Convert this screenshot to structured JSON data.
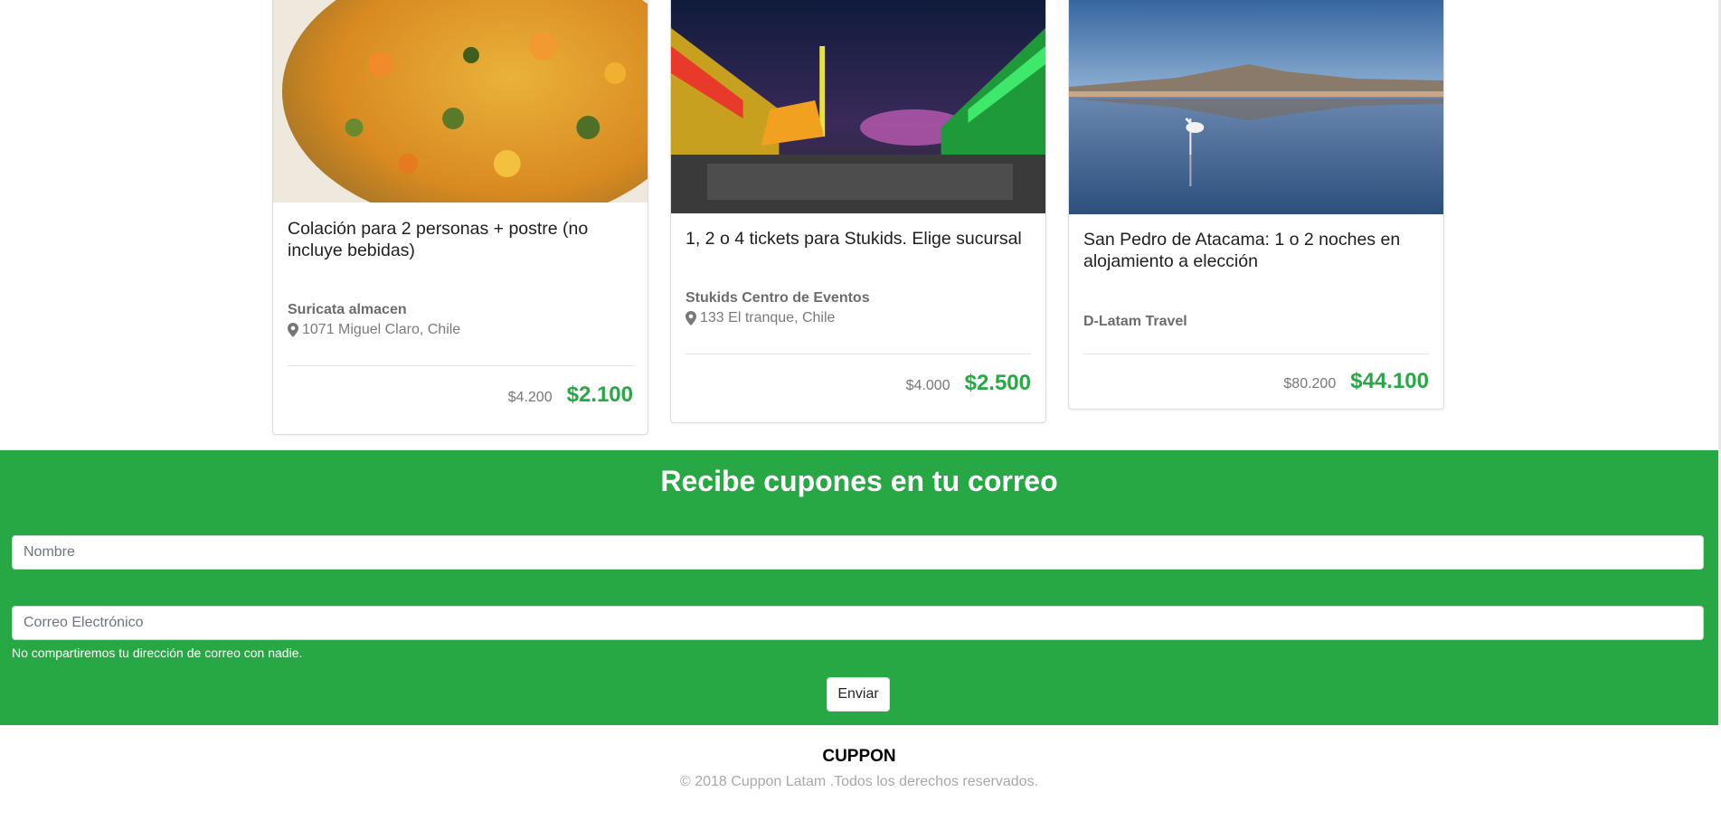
{
  "deals": [
    {
      "image": "food-dish-image",
      "title": "Colación para 2 personas + postre (no incluye bebidas)",
      "merchant": "Suricata almacen",
      "location": "1071 Miguel Claro, Chile",
      "old_price": "$4.200",
      "new_price": "$2.100"
    },
    {
      "image": "amusement-fair-image",
      "title": "1, 2 o 4 tickets para Stukids. Elige sucursal",
      "merchant": "Stukids Centro de Eventos",
      "location": "133 El tranque, Chile",
      "old_price": "$4.000",
      "new_price": "$2.500"
    },
    {
      "image": "flamingo-lake-image",
      "title": "San Pedro de Atacama: 1 o 2 noches en alojamiento a elección",
      "merchant": "D-Latam Travel",
      "location": "",
      "old_price": "$80.200",
      "new_price": "$44.100"
    }
  ],
  "newsletter": {
    "heading": "Recibe cupones en tu correo",
    "name_placeholder": "Nombre",
    "name_value": "",
    "email_placeholder": "Correo Electrónico",
    "email_value": "",
    "help_text": "No compartiremos tu dirección de correo con nadie.",
    "submit_label": "Enviar"
  },
  "footer": {
    "brand": "CUPPON",
    "copyright": "© 2018 Cuppon Latam .Todos los derechos reservados."
  },
  "colors": {
    "accent_green": "#28a745",
    "pin_icon": "location-pin-icon"
  }
}
